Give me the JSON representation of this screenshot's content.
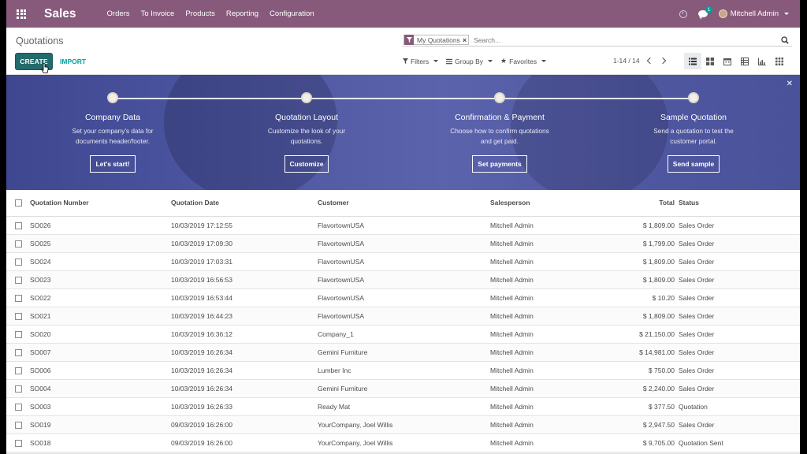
{
  "navbar": {
    "brand": "Sales",
    "menu": [
      "Orders",
      "To Invoice",
      "Products",
      "Reporting",
      "Configuration"
    ],
    "chat_badge": "1",
    "user_name": "Mitchell Admin",
    "color": "#875a7b"
  },
  "control_panel": {
    "title": "Quotations",
    "facet_label": "My Quotations",
    "search_placeholder": "Search...",
    "create_label": "CREATE",
    "import_label": "IMPORT",
    "filters_label": "Filters",
    "group_by_label": "Group By",
    "favorites_label": "Favorites",
    "pager": "1-14 / 14",
    "accent": "#00a09d",
    "primary": "#246b6b"
  },
  "banner": {
    "steps": [
      {
        "title": "Company Data",
        "desc1": "Set your company's data for",
        "desc2": "documents header/footer.",
        "button": "Let's start!"
      },
      {
        "title": "Quotation Layout",
        "desc1": "Customize the look of your",
        "desc2": "quotations.",
        "button": "Customize"
      },
      {
        "title": "Confirmation & Payment",
        "desc1": "Choose how to confirm quotations",
        "desc2": "and get paid.",
        "button": "Set payments"
      },
      {
        "title": "Sample Quotation",
        "desc1": "Send a quotation to test the",
        "desc2": "customer portal.",
        "button": "Send sample"
      }
    ],
    "color": "#4e57a1"
  },
  "table": {
    "headers": [
      "Quotation Number",
      "Quotation Date",
      "Customer",
      "Salesperson",
      "Total",
      "Status"
    ],
    "rows": [
      [
        "SO026",
        "10/03/2019 17:12:55",
        "FlavortownUSA",
        "Mitchell Admin",
        "$ 1,809.00",
        "Sales Order"
      ],
      [
        "SO025",
        "10/03/2019 17:09:30",
        "FlavortownUSA",
        "Mitchell Admin",
        "$ 1,799.00",
        "Sales Order"
      ],
      [
        "SO024",
        "10/03/2019 17:03:31",
        "FlavortownUSA",
        "Mitchell Admin",
        "$ 1,809.00",
        "Sales Order"
      ],
      [
        "SO023",
        "10/03/2019 16:56:53",
        "FlavortownUSA",
        "Mitchell Admin",
        "$ 1,809.00",
        "Sales Order"
      ],
      [
        "SO022",
        "10/03/2019 16:53:44",
        "FlavortownUSA",
        "Mitchell Admin",
        "$ 10.20",
        "Sales Order"
      ],
      [
        "SO021",
        "10/03/2019 16:44:23",
        "FlavortownUSA",
        "Mitchell Admin",
        "$ 1,809.00",
        "Sales Order"
      ],
      [
        "SO020",
        "10/03/2019 16:36:12",
        "Company_1",
        "Mitchell Admin",
        "$ 21,150.00",
        "Sales Order"
      ],
      [
        "SO007",
        "10/03/2019 16:26:34",
        "Gemini Furniture",
        "Mitchell Admin",
        "$ 14,981.00",
        "Sales Order"
      ],
      [
        "SO006",
        "10/03/2019 16:26:34",
        "Lumber Inc",
        "Mitchell Admin",
        "$ 750.00",
        "Sales Order"
      ],
      [
        "SO004",
        "10/03/2019 16:26:34",
        "Gemini Furniture",
        "Mitchell Admin",
        "$ 2,240.00",
        "Sales Order"
      ],
      [
        "SO003",
        "10/03/2019 16:26:33",
        "Ready Mat",
        "Mitchell Admin",
        "$ 377.50",
        "Quotation"
      ],
      [
        "SO019",
        "09/03/2019 16:26:00",
        "YourCompany, Joel Willis",
        "Mitchell Admin",
        "$ 2,947.50",
        "Sales Order"
      ],
      [
        "SO018",
        "09/03/2019 16:26:00",
        "YourCompany, Joel Willis",
        "Mitchell Admin",
        "$ 9,705.00",
        "Quotation Sent"
      ]
    ]
  }
}
